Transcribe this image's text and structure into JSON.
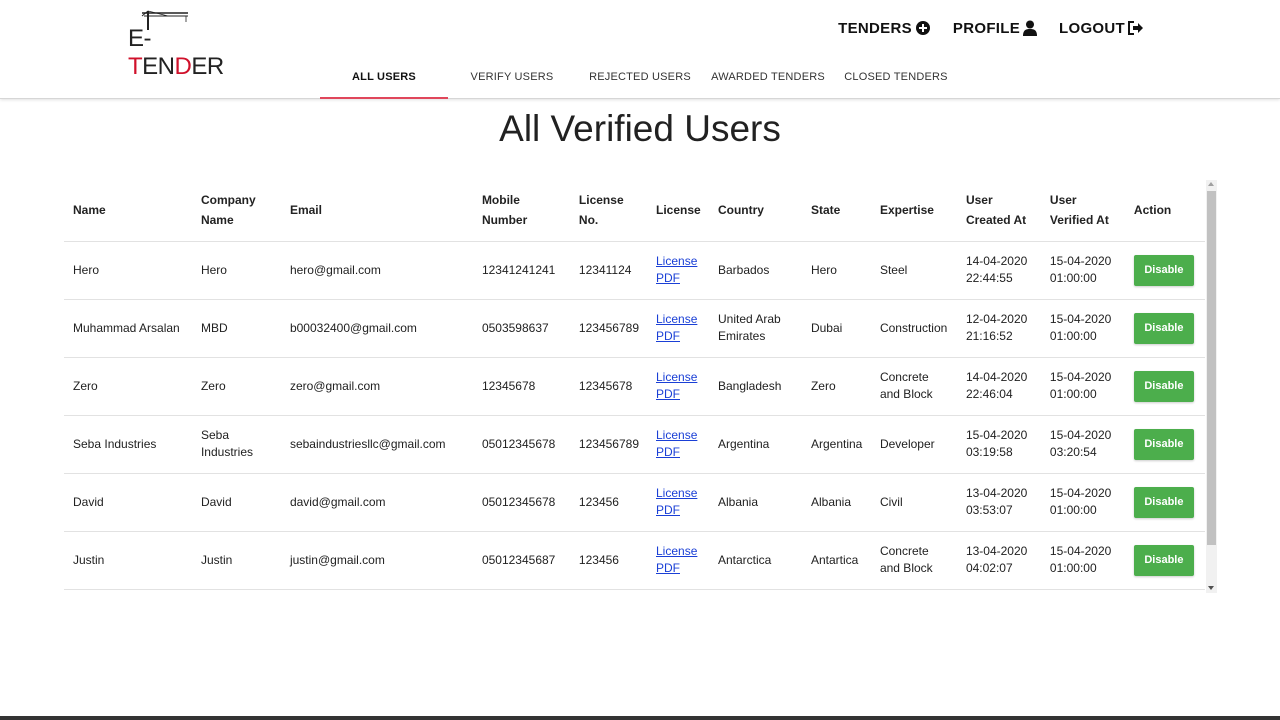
{
  "brand": {
    "logo_prefix": "E-",
    "logo_accent": "T",
    "logo_mid": "EN",
    "logo_accent2": "D",
    "logo_suffix": "ER"
  },
  "topnav": [
    {
      "label": "TENDERS",
      "icon": "plus-circle-icon"
    },
    {
      "label": "PROFILE",
      "icon": "user-icon"
    },
    {
      "label": "LOGOUT",
      "icon": "sign-out-icon"
    }
  ],
  "tabs": [
    {
      "label": "ALL USERS",
      "active": true
    },
    {
      "label": "VERIFY USERS",
      "active": false
    },
    {
      "label": "REJECTED USERS",
      "active": false
    },
    {
      "label": "AWARDED TENDERS",
      "active": false
    },
    {
      "label": "CLOSED TENDERS",
      "active": false
    }
  ],
  "page_title": "All Verified Users",
  "table": {
    "columns": [
      "Name",
      "Company Name",
      "Email",
      "Mobile Number",
      "License No.",
      "License",
      "Country",
      "State",
      "Expertise",
      "User Created At",
      "User Verified At",
      "Action"
    ],
    "rows": [
      {
        "name": "Hero",
        "company": "Hero",
        "email": "hero@gmail.com",
        "mobile": "12341241241",
        "license_no": "12341124",
        "license": "License PDF",
        "country": "Barbados",
        "state": "Hero",
        "expertise": "Steel",
        "created": "14-04-2020 22:44:55",
        "verified": "15-04-2020 01:00:00",
        "action": "Disable"
      },
      {
        "name": "Muhammad Arsalan",
        "company": "MBD",
        "email": "b00032400@gmail.com",
        "mobile": "0503598637",
        "license_no": "123456789",
        "license": "License PDF",
        "country": "United Arab Emirates",
        "state": "Dubai",
        "expertise": "Construction",
        "created": "12-04-2020 21:16:52",
        "verified": "15-04-2020 01:00:00",
        "action": "Disable"
      },
      {
        "name": "Zero",
        "company": "Zero",
        "email": "zero@gmail.com",
        "mobile": "12345678",
        "license_no": "12345678",
        "license": "License PDF",
        "country": "Bangladesh",
        "state": "Zero",
        "expertise": "Concrete and Block",
        "created": "14-04-2020 22:46:04",
        "verified": "15-04-2020 01:00:00",
        "action": "Disable"
      },
      {
        "name": "Seba Industries",
        "company": "Seba Industries",
        "email": "sebaindustriesllc@gmail.com",
        "mobile": "05012345678",
        "license_no": "123456789",
        "license": "License PDF",
        "country": "Argentina",
        "state": "Argentina",
        "expertise": "Developer",
        "created": "15-04-2020 03:19:58",
        "verified": "15-04-2020 03:20:54",
        "action": "Disable"
      },
      {
        "name": "David",
        "company": "David",
        "email": "david@gmail.com",
        "mobile": "05012345678",
        "license_no": "123456",
        "license": "License PDF",
        "country": "Albania",
        "state": "Albania",
        "expertise": "Civil",
        "created": "13-04-2020 03:53:07",
        "verified": "15-04-2020 01:00:00",
        "action": "Disable"
      },
      {
        "name": "Justin",
        "company": "Justin",
        "email": "justin@gmail.com",
        "mobile": "05012345687",
        "license_no": "123456",
        "license": "License PDF",
        "country": "Antarctica",
        "state": "Antartica",
        "expertise": "Concrete and Block",
        "created": "13-04-2020 04:02:07",
        "verified": "15-04-2020 01:00:00",
        "action": "Disable"
      }
    ]
  },
  "colors": {
    "tab_indicator": "#e0475b",
    "action_button": "#4cae4c",
    "link": "#1a3fd6",
    "logo_accent": "#d0112b"
  }
}
